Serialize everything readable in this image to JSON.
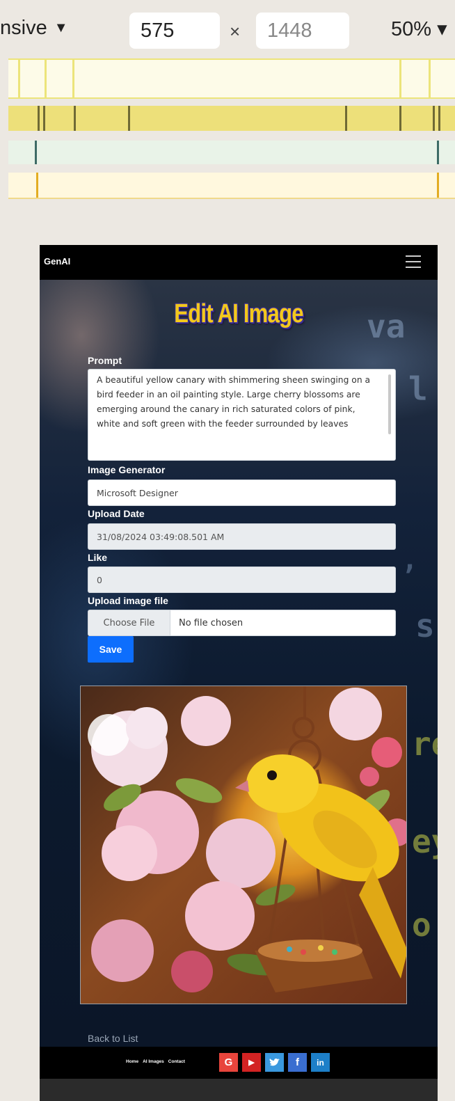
{
  "devtools": {
    "mode_label": "nsive",
    "width_value": "575",
    "times_symbol": "×",
    "height_value": "1448",
    "zoom_label": "50%"
  },
  "navbar": {
    "brand": "GenAI"
  },
  "page": {
    "title": "Edit AI Image"
  },
  "form": {
    "prompt_label": "Prompt",
    "prompt_value": "A beautiful yellow canary with shimmering sheen swinging on a bird feeder in an oil painting style. Large cherry blossoms are emerging around the canary in rich saturated colors of pink, white and soft green with the feeder surrounded by leaves",
    "generator_label": "Image Generator",
    "generator_value": "Microsoft Designer",
    "date_label": "Upload Date",
    "date_value": "31/08/2024 03:49:08.501 AM",
    "like_label": "Like",
    "like_value": "0",
    "upload_label": "Upload image file",
    "choose_file_label": "Choose File",
    "file_status": "No file chosen",
    "save_label": "Save"
  },
  "back_link": "Back to List",
  "footer": {
    "links": [
      "Home",
      "AI Images",
      "Contact"
    ],
    "social": [
      {
        "icon": "google-icon",
        "glyph": "G",
        "color": "#e8453c"
      },
      {
        "icon": "youtube-icon",
        "glyph": "▶",
        "color": "#d32323"
      },
      {
        "icon": "twitter-icon",
        "glyph": "🐦",
        "color": "#3a98de"
      },
      {
        "icon": "facebook-icon",
        "glyph": "f",
        "color": "#3a6ed0"
      },
      {
        "icon": "linkedin-icon",
        "glyph": "in",
        "color": "#1d7fc8"
      }
    ]
  },
  "colors": {
    "accent": "#0d6efd",
    "title": "#f3c81c",
    "navbar": "#000000"
  }
}
